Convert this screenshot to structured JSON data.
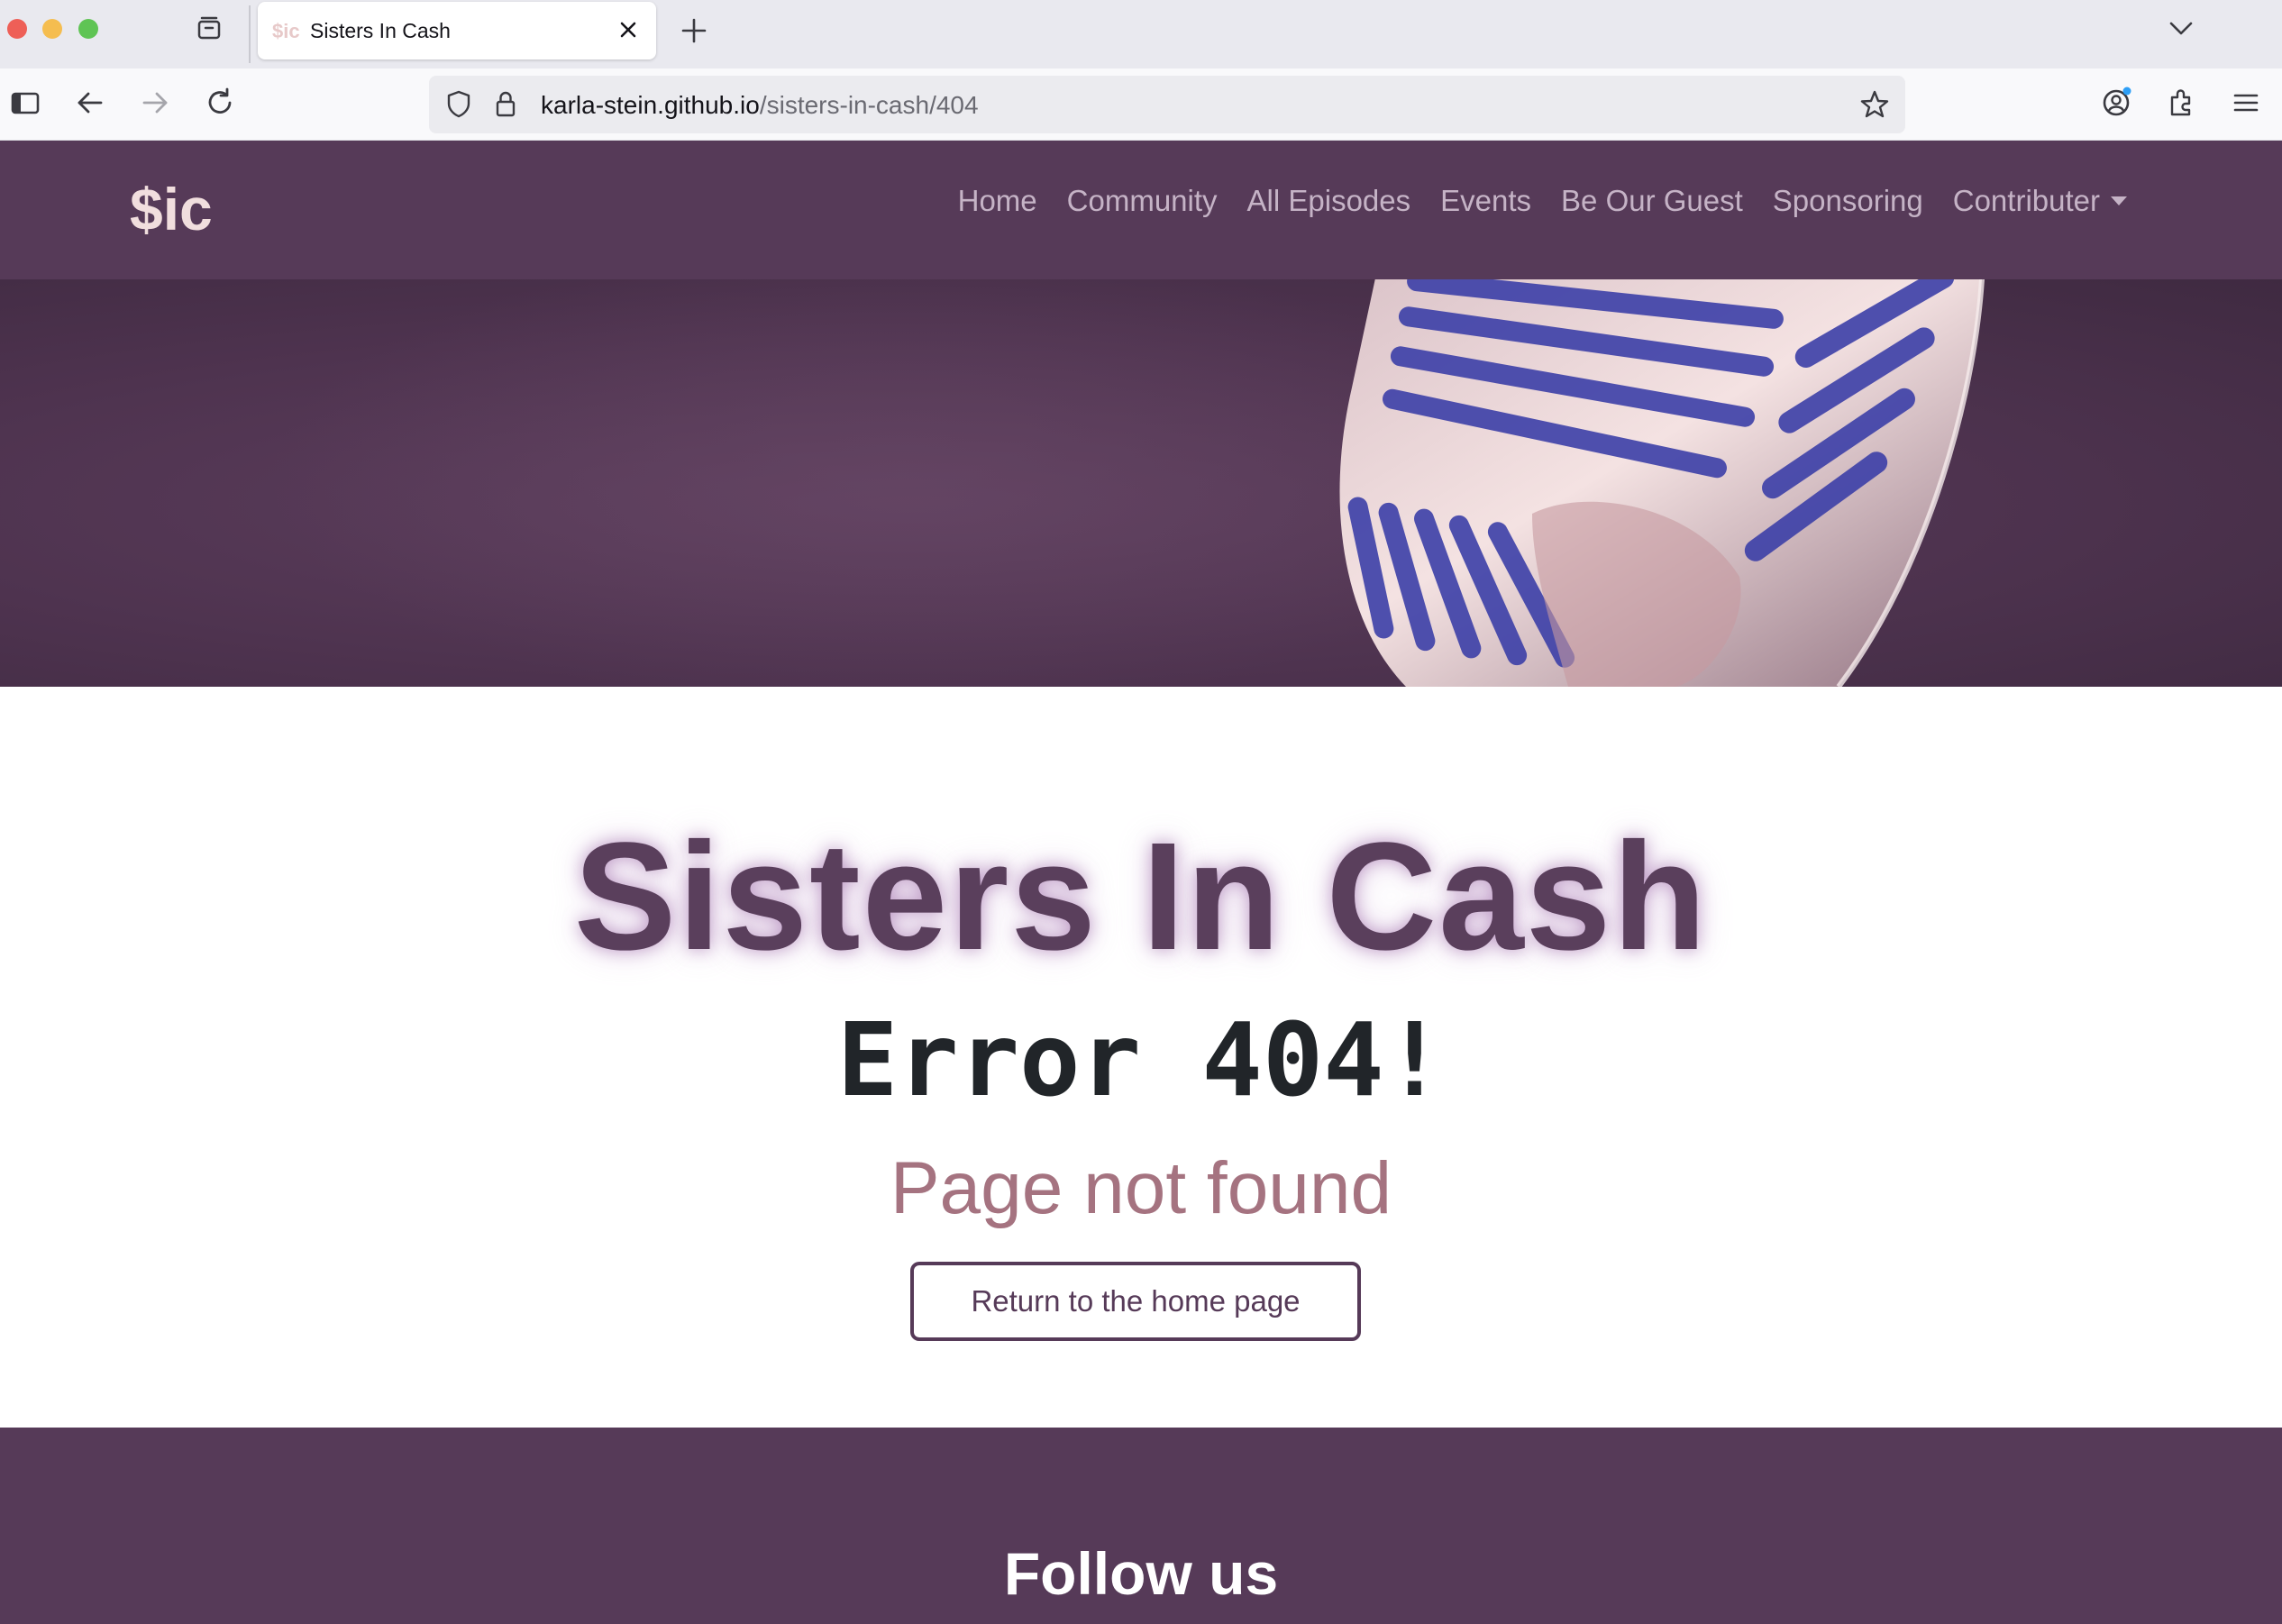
{
  "browser": {
    "tab": {
      "favicon_text": "$ic",
      "title": "Sisters In Cash"
    },
    "url": {
      "host": "karla-stein.github.io",
      "path": "/sisters-in-cash/404"
    }
  },
  "site_nav": {
    "brand": "$ic",
    "links": [
      "Home",
      "Community",
      "All Episodes",
      "Events",
      "Be Our Guest",
      "Sponsoring",
      "Contributer"
    ]
  },
  "main": {
    "title": "Sisters In Cash",
    "error": "Error 404!",
    "subtitle": "Page not found",
    "button_label": "Return to the home page"
  },
  "footer": {
    "heading": "Follow us"
  },
  "colors": {
    "brand_purple": "#563a58",
    "subtitle_pink": "#a57380",
    "brand_light": "#f1dede"
  }
}
